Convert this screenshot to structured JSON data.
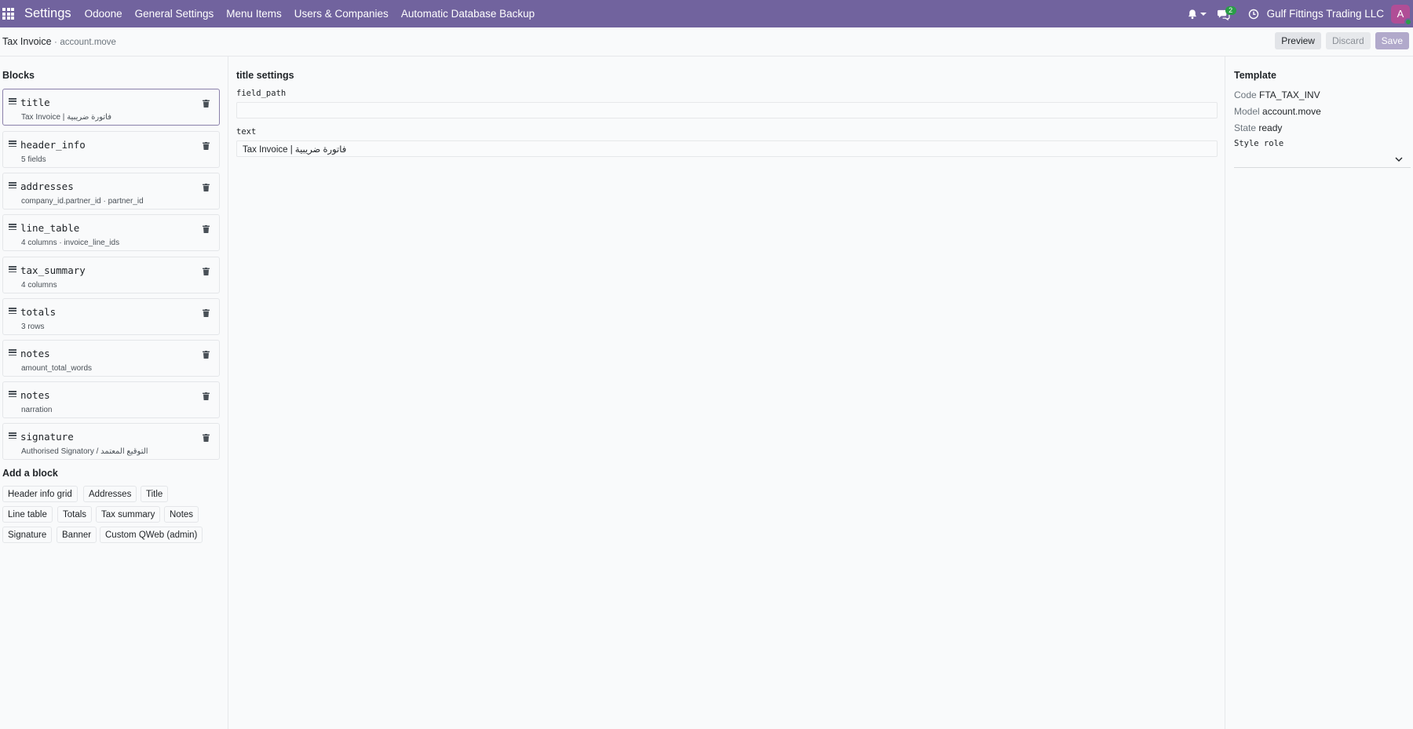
{
  "navbar": {
    "app_name": "Settings",
    "menu": [
      "Odoone",
      "General Settings",
      "Menu Items",
      "Users & Companies",
      "Automatic Database Backup"
    ],
    "messages_badge": "2",
    "company": "Gulf Fittings Trading LLC",
    "avatar_initial": "A",
    "icons": [
      "apps-grid-icon",
      "bell-icon",
      "chat-icon",
      "clock-icon"
    ],
    "colors": {
      "bar": "#71639e",
      "avatar": "#b04e96",
      "presence": "#2a9d48"
    }
  },
  "control_panel": {
    "title": "Tax Invoice",
    "separator": "·",
    "model": "account.move",
    "preview_label": "Preview",
    "discard_label": "Discard",
    "save_label": "Save"
  },
  "blocks": {
    "heading": "Blocks",
    "items": [
      {
        "title": "title",
        "sub": "Tax Invoice | فاتورة ضريبية"
      },
      {
        "title": "header_info",
        "sub": "5 fields"
      },
      {
        "title": "addresses",
        "sub": "company_id.partner_id · partner_id"
      },
      {
        "title": "line_table",
        "sub": "4 columns · invoice_line_ids"
      },
      {
        "title": "tax_summary",
        "sub": "4 columns"
      },
      {
        "title": "totals",
        "sub": "3 rows"
      },
      {
        "title": "notes",
        "sub": "amount_total_words"
      },
      {
        "title": "notes",
        "sub": "narration"
      },
      {
        "title": "signature",
        "sub": "Authorised Signatory / التوقيع المعتمد"
      }
    ]
  },
  "add_block": {
    "heading": "Add a block",
    "options": [
      "Header info grid",
      "Addresses",
      "Title",
      "Line table",
      "Totals",
      "Tax summary",
      "Notes",
      "Signature",
      "Banner",
      "Custom QWeb (admin)"
    ]
  },
  "settings": {
    "heading": "title settings",
    "field_path_label": "field_path",
    "field_path_value": "",
    "text_label": "text",
    "text_value": "Tax Invoice  |  فاتورة ضريبية"
  },
  "template": {
    "heading": "Template",
    "code_key": "Code",
    "code_value": "FTA_TAX_INV",
    "model_key": "Model",
    "model_value": "account.move",
    "state_key": "State",
    "state_value": "ready",
    "style_role_label": "Style role",
    "style_role_value": ""
  }
}
